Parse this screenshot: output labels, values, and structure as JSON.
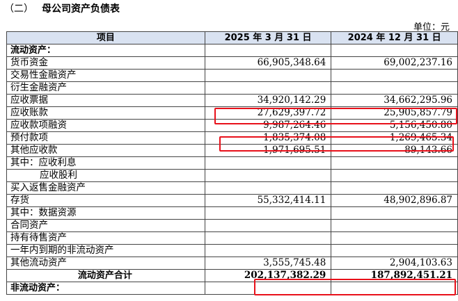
{
  "section_no": "（二）",
  "title": "母公司资产负债表",
  "unit": "单位：元",
  "headers": {
    "item": "项目",
    "col_a": "2025 年 3 月 31 日",
    "col_b": "2024 年 12 月 31 日"
  },
  "rows": [
    {
      "label": "流动资产：",
      "a": "",
      "b": ""
    },
    {
      "label": "货币资金",
      "a": "66,905,348.64",
      "b": "69,002,237.16"
    },
    {
      "label": "交易性金融资产",
      "a": "",
      "b": ""
    },
    {
      "label": "衍生金融资产",
      "a": "",
      "b": ""
    },
    {
      "label": "应收票据",
      "a": "34,920,142.29",
      "b": "34,662,295.96"
    },
    {
      "label": "应收账款",
      "a": "27,629,397.72",
      "b": "25,905,857.79"
    },
    {
      "label": "应收款项融资",
      "a": "9,987,264.46",
      "b": "5,156,450.80"
    },
    {
      "label": "预付款项",
      "a": "1,835,374.08",
      "b": "1,269,465.34"
    },
    {
      "label": "其他应收款",
      "a": "1,971,695.51",
      "b": "89,143.66"
    },
    {
      "label": "其中：应收利息",
      "a": "",
      "b": ""
    },
    {
      "label": "应收股利",
      "a": "",
      "b": ""
    },
    {
      "label": "买入返售金融资产",
      "a": "",
      "b": ""
    },
    {
      "label": "存货",
      "a": "55,332,414.11",
      "b": "48,902,896.87"
    },
    {
      "label": "其中：数据资源",
      "a": "",
      "b": ""
    },
    {
      "label": "合同资产",
      "a": "",
      "b": ""
    },
    {
      "label": "持有待售资产",
      "a": "",
      "b": ""
    },
    {
      "label": "一年内到期的非流动资产",
      "a": "",
      "b": ""
    },
    {
      "label": "其他流动资产",
      "a": "3,555,745.48",
      "b": "2,904,103.63"
    },
    {
      "label": "流动资产合计",
      "a": "202,137,382.29",
      "b": "187,892,451.21"
    },
    {
      "label": "非流动资产：",
      "a": "",
      "b": ""
    }
  ],
  "highlight_color": "#e8101a"
}
